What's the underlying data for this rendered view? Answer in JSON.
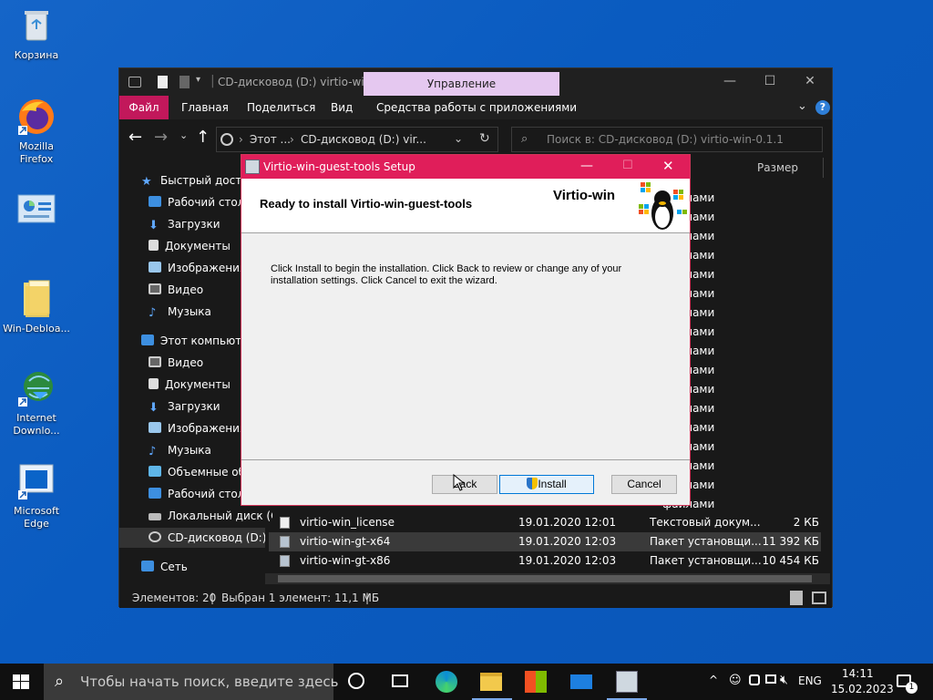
{
  "desktop": {
    "icons": [
      {
        "label": "Корзина",
        "icon": "recycle-bin-icon"
      },
      {
        "label": "Mozilla Firefox",
        "icon": "firefox-icon"
      },
      {
        "label": "",
        "icon": "control-panel-icon"
      },
      {
        "label": "Win-Debloa...",
        "icon": "folder-icon"
      },
      {
        "label": "Internet Downlo...",
        "icon": "internet-download-manager-icon"
      },
      {
        "label": "Microsoft Edge",
        "icon": "edge-icon"
      }
    ]
  },
  "explorer": {
    "title": "CD-дисковод (D:) virtio-win...",
    "manage_tab": "Управление",
    "ribbon": {
      "file": "Файл",
      "home": "Главная",
      "share": "Поделиться",
      "view": "Вид",
      "app_tools": "Средства работы с приложениями"
    },
    "address": {
      "part1": "Этот ...",
      "sep": "›",
      "part2": "CD-дисковод (D:) vir..."
    },
    "search_placeholder": "Поиск в: CD-дисковод (D:) virtio-win-0.1.1",
    "column_size": "Размер",
    "nav": {
      "quick_access": "Быстрый доступ",
      "quick_items": [
        "Рабочий стол",
        "Загрузки",
        "Документы",
        "Изображения",
        "Видео",
        "Музыка"
      ],
      "this_pc": "Этот компьютер",
      "pc_items": [
        "Видео",
        "Документы",
        "Загрузки",
        "Изображения",
        "Музыка",
        "Объемные объ",
        "Рабочий стол",
        "Локальный диск (C",
        "CD-дисковод (D:) v"
      ],
      "network": "Сеть"
    },
    "partial_rows": "файлами",
    "files": [
      {
        "name": "virtio-win_license",
        "date": "19.01.2020 12:01",
        "type": "Текстовый докум...",
        "size": "2 КБ"
      },
      {
        "name": "virtio-win-gt-x64",
        "date": "19.01.2020 12:03",
        "type": "Пакет установщи...",
        "size": "11 392 КБ"
      },
      {
        "name": "virtio-win-gt-x86",
        "date": "19.01.2020 12:03",
        "type": "Пакет установщи...",
        "size": "10 454 КБ"
      }
    ],
    "status": {
      "count": "Элементов: 20",
      "selected": "Выбран 1 элемент: 11,1 МБ"
    }
  },
  "setup": {
    "title": "Virtio-win-guest-tools Setup",
    "heading": "Ready to install Virtio-win-guest-tools",
    "brand": "Virtio-win",
    "body_line1": "Click Install to begin the installation. Click Back to review or change any of your",
    "body_line2": "installation settings. Click Cancel to exit the wizard.",
    "back": "Back",
    "install": "Install",
    "cancel": "Cancel"
  },
  "taskbar": {
    "search_placeholder": "Чтобы начать поиск, введите здесь",
    "lang": "ENG",
    "time": "14:11",
    "date": "15.02.2023",
    "notification_count": "1"
  },
  "colors": {
    "accent": "#e01e5a",
    "desktop": "#0a5bc0",
    "explorer_bg": "#191919"
  }
}
